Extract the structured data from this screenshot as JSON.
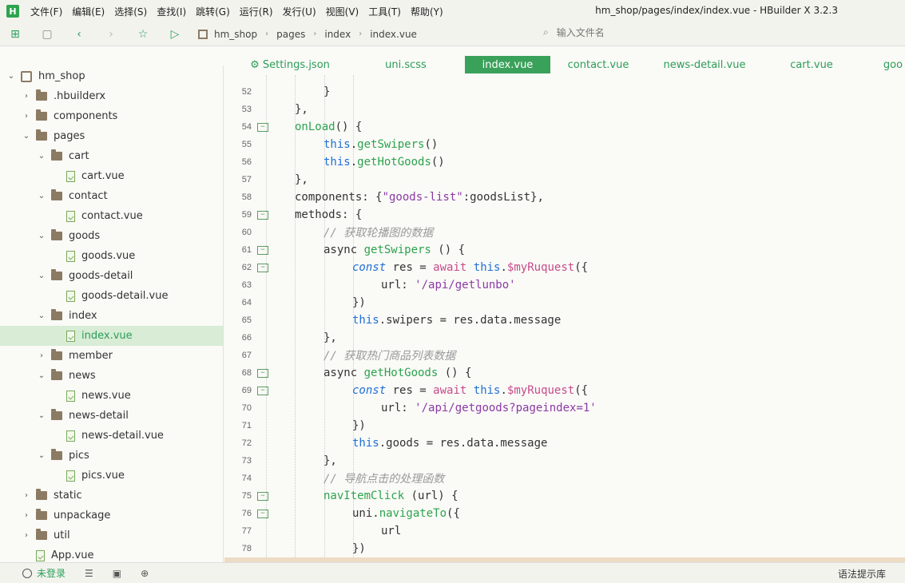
{
  "app": {
    "title": "hm_shop/pages/index/index.vue - HBuilder X 3.2.3",
    "logo_letter": "H",
    "menu": [
      "文件(F)",
      "编辑(E)",
      "选择(S)",
      "查找(I)",
      "跳转(G)",
      "运行(R)",
      "发行(U)",
      "视图(V)",
      "工具(T)",
      "帮助(Y)"
    ]
  },
  "toolbar": {
    "breadcrumb": [
      "hm_shop",
      "pages",
      "index",
      "index.vue"
    ],
    "search_placeholder": "输入文件名"
  },
  "sidebar": {
    "items": [
      {
        "label": "hm_shop",
        "kind": "project",
        "depth": 0,
        "expanded": true
      },
      {
        "label": ".hbuilderx",
        "kind": "folder",
        "depth": 1,
        "expanded": false
      },
      {
        "label": "components",
        "kind": "folder",
        "depth": 1,
        "expanded": false
      },
      {
        "label": "pages",
        "kind": "folder",
        "depth": 1,
        "expanded": true
      },
      {
        "label": "cart",
        "kind": "folder",
        "depth": 2,
        "expanded": true
      },
      {
        "label": "cart.vue",
        "kind": "file",
        "depth": 3
      },
      {
        "label": "contact",
        "kind": "folder",
        "depth": 2,
        "expanded": true
      },
      {
        "label": "contact.vue",
        "kind": "file",
        "depth": 3
      },
      {
        "label": "goods",
        "kind": "folder",
        "depth": 2,
        "expanded": true
      },
      {
        "label": "goods.vue",
        "kind": "file",
        "depth": 3
      },
      {
        "label": "goods-detail",
        "kind": "folder",
        "depth": 2,
        "expanded": true
      },
      {
        "label": "goods-detail.vue",
        "kind": "file",
        "depth": 3
      },
      {
        "label": "index",
        "kind": "folder",
        "depth": 2,
        "expanded": true
      },
      {
        "label": "index.vue",
        "kind": "file",
        "depth": 3,
        "selected": true
      },
      {
        "label": "member",
        "kind": "folder",
        "depth": 2,
        "expanded": false
      },
      {
        "label": "news",
        "kind": "folder",
        "depth": 2,
        "expanded": true
      },
      {
        "label": "news.vue",
        "kind": "file",
        "depth": 3
      },
      {
        "label": "news-detail",
        "kind": "folder",
        "depth": 2,
        "expanded": true
      },
      {
        "label": "news-detail.vue",
        "kind": "file",
        "depth": 3
      },
      {
        "label": "pics",
        "kind": "folder",
        "depth": 2,
        "expanded": true
      },
      {
        "label": "pics.vue",
        "kind": "file",
        "depth": 3
      },
      {
        "label": "static",
        "kind": "folder",
        "depth": 1,
        "expanded": false
      },
      {
        "label": "unpackage",
        "kind": "folder",
        "depth": 1,
        "expanded": false
      },
      {
        "label": "util",
        "kind": "folder",
        "depth": 1,
        "expanded": false
      },
      {
        "label": "App.vue",
        "kind": "file",
        "depth": 1
      }
    ]
  },
  "tabs": [
    {
      "label": "⚙ Settings.json"
    },
    {
      "label": "uni.scss"
    },
    {
      "label": "index.vue",
      "active": true
    },
    {
      "label": "contact.vue"
    },
    {
      "label": "news-detail.vue"
    },
    {
      "label": "cart.vue"
    },
    {
      "label": "goo"
    }
  ],
  "editor": {
    "lines": [
      {
        "n": "52",
        "fold": false,
        "indent": 3,
        "tokens": [
          [
            "pu",
            "}"
          ]
        ]
      },
      {
        "n": "53",
        "fold": false,
        "indent": 2,
        "tokens": [
          [
            "pu",
            "},"
          ]
        ]
      },
      {
        "n": "54",
        "fold": true,
        "indent": 2,
        "tokens": [
          [
            "fn",
            "onLoad"
          ],
          [
            "pu",
            "() {"
          ]
        ]
      },
      {
        "n": "55",
        "fold": false,
        "indent": 3,
        "tokens": [
          [
            "kw",
            "this"
          ],
          [
            "pu",
            "."
          ],
          [
            "fn",
            "getSwipers"
          ],
          [
            "pu",
            "()"
          ]
        ]
      },
      {
        "n": "56",
        "fold": false,
        "indent": 3,
        "tokens": [
          [
            "kw",
            "this"
          ],
          [
            "pu",
            "."
          ],
          [
            "fn",
            "getHotGoods"
          ],
          [
            "pu",
            "()"
          ]
        ]
      },
      {
        "n": "57",
        "fold": false,
        "indent": 2,
        "tokens": [
          [
            "pu",
            "},"
          ]
        ]
      },
      {
        "n": "58",
        "fold": false,
        "indent": 2,
        "tokens": [
          [
            "pu",
            "components: {"
          ],
          [
            "str",
            "\"goods-list\""
          ],
          [
            "pu",
            ":goodsList},"
          ]
        ]
      },
      {
        "n": "59",
        "fold": true,
        "indent": 2,
        "tokens": [
          [
            "pu",
            "methods: {"
          ]
        ]
      },
      {
        "n": "60",
        "fold": false,
        "indent": 3,
        "tokens": [
          [
            "cm",
            "// 获取轮播图的数据"
          ]
        ]
      },
      {
        "n": "61",
        "fold": true,
        "indent": 3,
        "tokens": [
          [
            "pu",
            "async "
          ],
          [
            "fn",
            "getSwipers"
          ],
          [
            "pu",
            " () {"
          ]
        ]
      },
      {
        "n": "62",
        "fold": true,
        "indent": 4,
        "tokens": [
          [
            "kwi",
            "const"
          ],
          [
            "pu",
            " res = "
          ],
          [
            "aw",
            "await"
          ],
          [
            "pu",
            " "
          ],
          [
            "kw",
            "this"
          ],
          [
            "pu",
            "."
          ],
          [
            "aw",
            "$myRuquest"
          ],
          [
            "pu",
            "({"
          ]
        ]
      },
      {
        "n": "63",
        "fold": false,
        "indent": 5,
        "tokens": [
          [
            "pu",
            "url: "
          ],
          [
            "str",
            "'/api/getlunbo'"
          ]
        ]
      },
      {
        "n": "64",
        "fold": false,
        "indent": 4,
        "tokens": [
          [
            "pu",
            "})"
          ]
        ]
      },
      {
        "n": "65",
        "fold": false,
        "indent": 4,
        "tokens": [
          [
            "kw",
            "this"
          ],
          [
            "pu",
            ".swipers = res.data.message"
          ]
        ]
      },
      {
        "n": "66",
        "fold": false,
        "indent": 3,
        "tokens": [
          [
            "pu",
            "},"
          ]
        ]
      },
      {
        "n": "67",
        "fold": false,
        "indent": 3,
        "tokens": [
          [
            "cm",
            "// 获取热门商品列表数据"
          ]
        ]
      },
      {
        "n": "68",
        "fold": true,
        "indent": 3,
        "tokens": [
          [
            "pu",
            "async "
          ],
          [
            "fn",
            "getHotGoods"
          ],
          [
            "pu",
            " () {"
          ]
        ]
      },
      {
        "n": "69",
        "fold": true,
        "indent": 4,
        "tokens": [
          [
            "kwi",
            "const"
          ],
          [
            "pu",
            " res = "
          ],
          [
            "aw",
            "await"
          ],
          [
            "pu",
            " "
          ],
          [
            "kw",
            "this"
          ],
          [
            "pu",
            "."
          ],
          [
            "aw",
            "$myRuquest"
          ],
          [
            "pu",
            "({"
          ]
        ]
      },
      {
        "n": "70",
        "fold": false,
        "indent": 5,
        "tokens": [
          [
            "pu",
            "url: "
          ],
          [
            "str",
            "'/api/getgoods?pageindex=1'"
          ]
        ]
      },
      {
        "n": "71",
        "fold": false,
        "indent": 4,
        "tokens": [
          [
            "pu",
            "})"
          ]
        ]
      },
      {
        "n": "72",
        "fold": false,
        "indent": 4,
        "tokens": [
          [
            "kw",
            "this"
          ],
          [
            "pu",
            ".goods = res.data.message"
          ]
        ]
      },
      {
        "n": "73",
        "fold": false,
        "indent": 3,
        "tokens": [
          [
            "pu",
            "},"
          ]
        ]
      },
      {
        "n": "74",
        "fold": false,
        "indent": 3,
        "tokens": [
          [
            "cm",
            "// 导航点击的处理函数"
          ]
        ]
      },
      {
        "n": "75",
        "fold": true,
        "indent": 3,
        "tokens": [
          [
            "fn",
            "navItemClick"
          ],
          [
            "pu",
            " (url) {"
          ]
        ]
      },
      {
        "n": "76",
        "fold": true,
        "indent": 4,
        "tokens": [
          [
            "pu",
            "uni."
          ],
          [
            "fn",
            "navigateTo"
          ],
          [
            "pu",
            "({"
          ]
        ]
      },
      {
        "n": "77",
        "fold": false,
        "indent": 5,
        "tokens": [
          [
            "pu",
            "url"
          ]
        ]
      },
      {
        "n": "78",
        "fold": false,
        "indent": 4,
        "tokens": [
          [
            "pu",
            "})"
          ]
        ]
      }
    ]
  },
  "status": {
    "user_label": "未登录",
    "right_label": "语法提示库"
  }
}
